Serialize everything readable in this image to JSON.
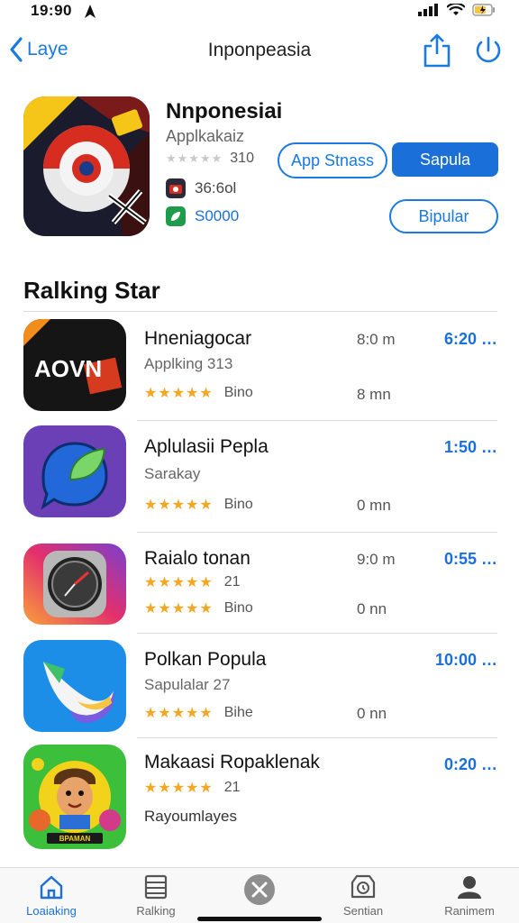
{
  "status_bar": {
    "time": "19:90"
  },
  "nav": {
    "back_label": "Laye",
    "title": "Inponpeasia"
  },
  "featured": {
    "name": "Nnponesiai",
    "subtitle": "Applkakaiz",
    "rating_value": "310",
    "meta_1": "36:6ol",
    "meta_2": "S0000",
    "button_app_store": "App Stnass",
    "button_primary": "Sapula",
    "button_secondary": "Bipular"
  },
  "section": {
    "title": "Ralking Star"
  },
  "rows": [
    {
      "icon_text": "AOVN",
      "name": "Hneniagocar",
      "line2": "Applking 313",
      "stars_label": "Bino",
      "mid_top": "8:0 m",
      "mid_bottom": "8 mn",
      "right": "6:20 …"
    },
    {
      "name": "Aplulasii Pepla",
      "line2": "Sarakay",
      "stars_label": "Bino",
      "mid_bottom": "0 mn",
      "right": "1:50 …"
    },
    {
      "name": "Raialo tonan",
      "line2": "21",
      "stars_label": "Bino",
      "mid_top": "9:0 m",
      "mid_bottom": "0 nn",
      "right": "0:55 …"
    },
    {
      "name": "Polkan Popula",
      "line2": "Sapulalar 27",
      "stars_label": "Bihe",
      "mid_bottom": "0 nn",
      "right": "10:00 …"
    },
    {
      "icon_text": "BPAMAN",
      "name": "Makaasi Ropaklenak",
      "line2": "21",
      "line3": "Rayoumlayes",
      "right": "0:20 …"
    }
  ],
  "tabs": [
    {
      "label": "Loaiaking",
      "icon": "home-icon"
    },
    {
      "label": "Ralking",
      "icon": "list-icon"
    },
    {
      "label": "",
      "icon": "close-icon"
    },
    {
      "label": "Sentian",
      "icon": "clock-icon"
    },
    {
      "label": "Ranimem",
      "icon": "person-icon"
    }
  ],
  "colors": {
    "accent": "#1a6fd8",
    "star": "#f5a623"
  }
}
